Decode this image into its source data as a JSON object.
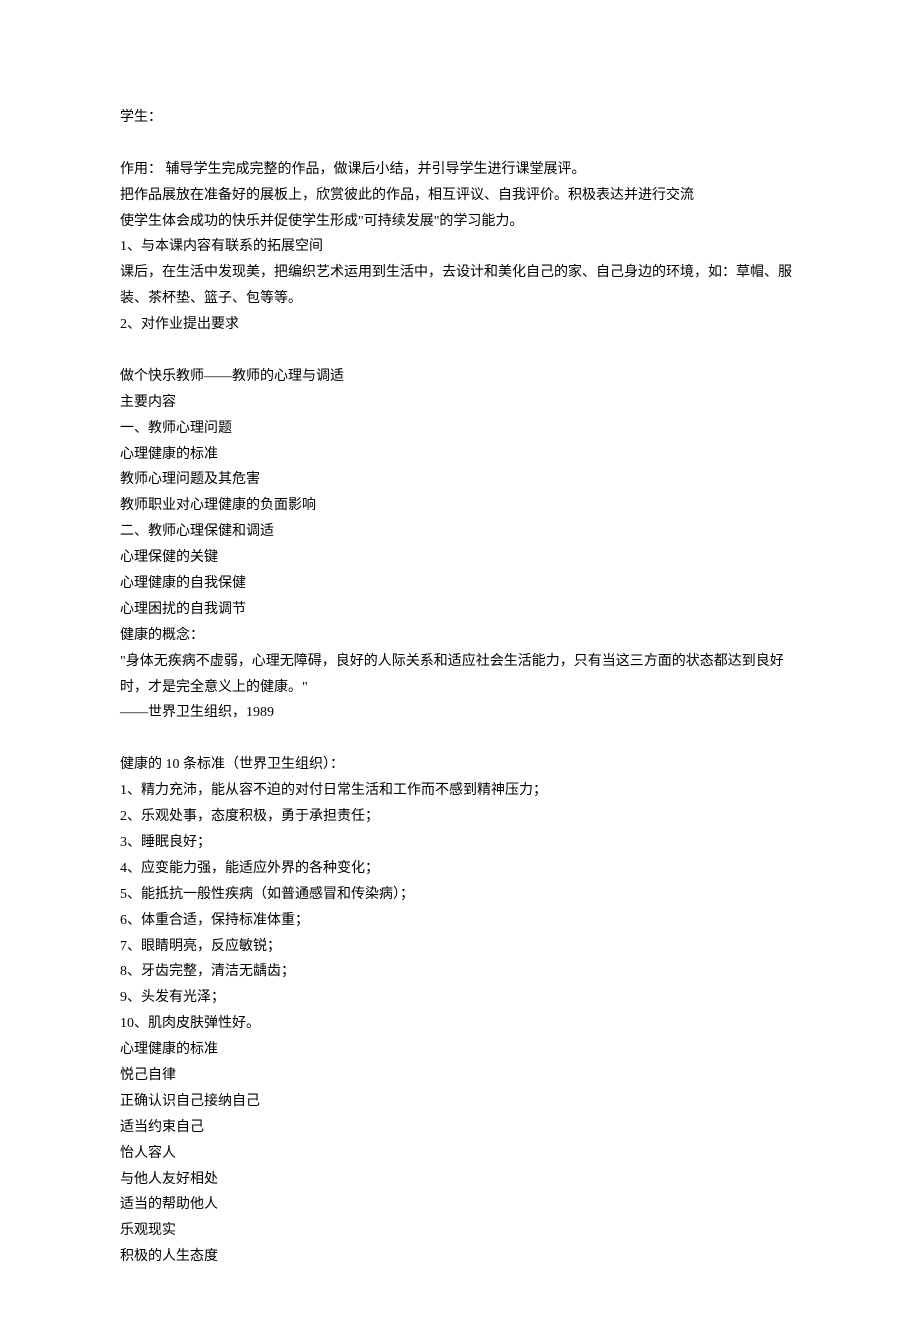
{
  "lines": [
    "学生：",
    "",
    "作用： 辅导学生完成完整的作品，做课后小结，并引导学生进行课堂展评。",
    "把作品展放在准备好的展板上，欣赏彼此的作品，相互评议、自我评价。积极表达并进行交流",
    "使学生体会成功的快乐并促使学生形成\"可持续发展\"的学习能力。",
    "1、与本课内容有联系的拓展空间",
    "课后，在生活中发现美，把编织艺术运用到生活中，去设计和美化自己的家、自己身边的环境，如：草帽、服装、茶杯垫、篮子、包等等。",
    "2、对作业提出要求",
    "",
    "做个快乐教师——教师的心理与调适",
    "主要内容",
    "一、教师心理问题",
    "心理健康的标准",
    "教师心理问题及其危害",
    "教师职业对心理健康的负面影响",
    "二、教师心理保健和调适",
    "心理保健的关键",
    "心理健康的自我保健",
    "心理困扰的自我调节",
    "健康的概念：",
    "\"身体无疾病不虚弱，心理无障碍，良好的人际关系和适应社会生活能力，只有当这三方面的状态都达到良好时，才是完全意义上的健康。\"",
    "——世界卫生组织，1989",
    "",
    "健康的 10 条标准（世界卫生组织）：",
    "1、精力充沛，能从容不迫的对付日常生活和工作而不感到精神压力；",
    "2、乐观处事，态度积极，勇于承担责任；",
    "3、睡眠良好；",
    "4、应变能力强，能适应外界的各种变化；",
    "5、能抵抗一般性疾病（如普通感冒和传染病）；",
    "6、体重合适，保持标准体重；",
    "7、眼睛明亮，反应敏锐；",
    "8、牙齿完整，清洁无龋齿；",
    "9、头发有光泽；",
    "10、肌肉皮肤弹性好。",
    "心理健康的标准",
    "悦己自律",
    "正确认识自己接纳自己",
    "适当约束自己",
    "怡人容人",
    "与他人友好相处",
    "适当的帮助他人",
    "乐观现实",
    "积极的人生态度"
  ]
}
